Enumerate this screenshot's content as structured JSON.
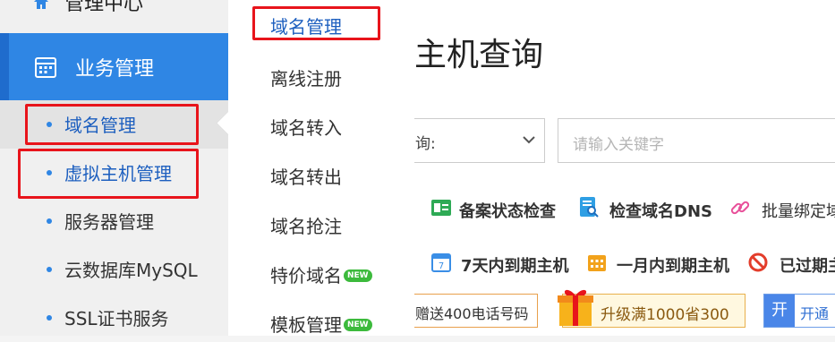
{
  "sidebar": {
    "top_label": "管理中心",
    "active_label": "业务管理",
    "items": [
      {
        "label": "域名管理"
      },
      {
        "label": "虚拟主机管理"
      },
      {
        "label": "服务器管理"
      },
      {
        "label": "云数据库MySQL"
      },
      {
        "label": "SSL证书服务"
      }
    ]
  },
  "flyout": {
    "items": [
      {
        "label": "域名管理"
      },
      {
        "label": "离线注册"
      },
      {
        "label": "域名转入"
      },
      {
        "label": "域名转出"
      },
      {
        "label": "域名抢注"
      },
      {
        "label": "特价域名",
        "badge": "NEW"
      },
      {
        "label": "模板管理",
        "badge": "NEW"
      }
    ]
  },
  "main": {
    "title": "主机查询",
    "select_value": "询:",
    "search_placeholder": "请输入关键字",
    "links_row1": [
      "备案状态检查",
      "检查域名DNS",
      "批量绑定域"
    ],
    "links_row2": [
      "7天内到期主机",
      "一月内到期主机",
      "已过期主"
    ],
    "promos": {
      "gift_phone": "赠送400电话号码",
      "upgrade": "升级满1000省300",
      "open_key": "开",
      "open_label": "开通"
    }
  },
  "colors": {
    "accent": "#2f86e4",
    "highlight": "#e8141b",
    "new_badge": "#3cba3c"
  }
}
